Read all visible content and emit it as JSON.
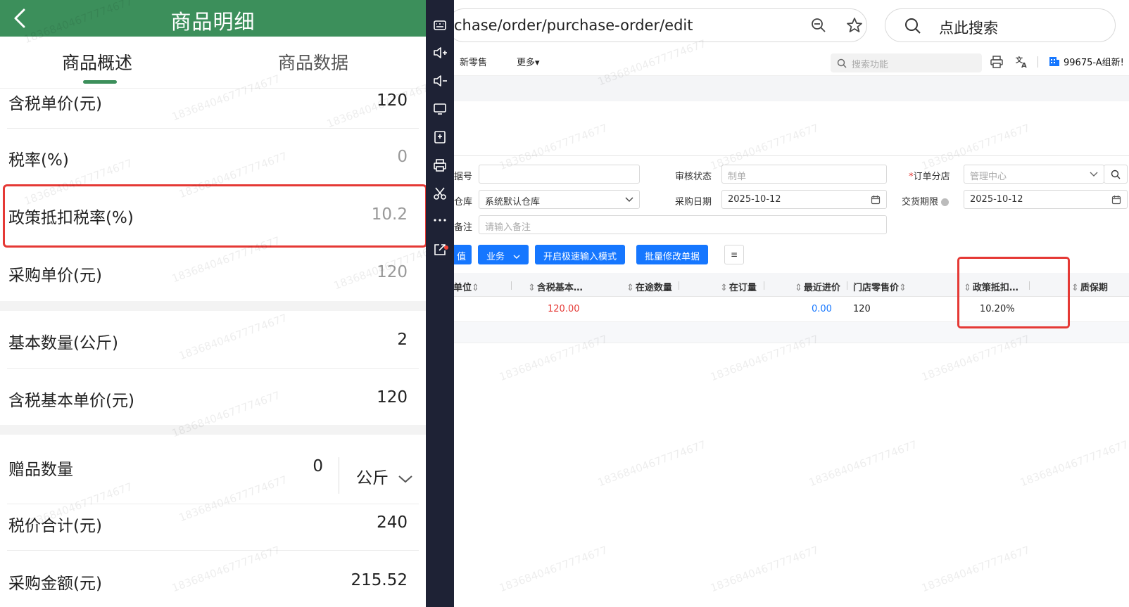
{
  "mobile": {
    "title": "商品明细",
    "tabs": [
      "商品概述",
      "商品数据"
    ],
    "rows": {
      "tax_price": {
        "label": "含税单价(元)",
        "value": "120"
      },
      "tax_rate": {
        "label": "税率(%)",
        "value": "0"
      },
      "policy_rate": {
        "label": "政策抵扣税率(%)",
        "value": "10.2"
      },
      "purchase_price": {
        "label": "采购单价(元)",
        "value": "120"
      },
      "base_qty": {
        "label": "基本数量(公斤)",
        "value": "2"
      },
      "tax_base_price": {
        "label": "含税基本单价(元)",
        "value": "120"
      },
      "gift_qty": {
        "label": "赠品数量",
        "value": "0",
        "unit": "公斤"
      },
      "total": {
        "label": "税价合计(元)",
        "value": "240"
      },
      "amount": {
        "label": "采购金额(元)",
        "value": "215.52"
      }
    },
    "watermark": "18368404677774677"
  },
  "browser": {
    "url": "chase/order/purchase-order/edit",
    "search_placeholder": "点此搜索",
    "menu": [
      "新零售",
      "更多▾"
    ],
    "func_search_placeholder": "搜索功能",
    "user": "99675-A组新!",
    "form": {
      "doc_no_label": "据号",
      "doc_no_value": "",
      "audit_label": "审核状态",
      "audit_value": "制单",
      "branch_label": "订单分店",
      "branch_value": "管理中心",
      "warehouse_label": "仓库",
      "warehouse_value": "系统默认仓库",
      "purchase_date_label": "采购日期",
      "purchase_date_value": "2025-10-12",
      "delivery_label": "交货期限",
      "delivery_value": "2025-10-12",
      "remark_label": "备注",
      "remark_placeholder": "请输入备注"
    },
    "buttons": [
      "值",
      "业务",
      "开启极速输入模式",
      "批量修改单据"
    ],
    "table": {
      "headers": [
        "单位",
        "含税基本…",
        "在途数量",
        "在订量",
        "最近进价",
        "门店零售价",
        "政策抵扣…",
        "质保期"
      ],
      "row": {
        "tax_base": "120.00",
        "recent_price": "0.00",
        "retail_price": "120",
        "policy_rate": "10.20%"
      }
    }
  }
}
